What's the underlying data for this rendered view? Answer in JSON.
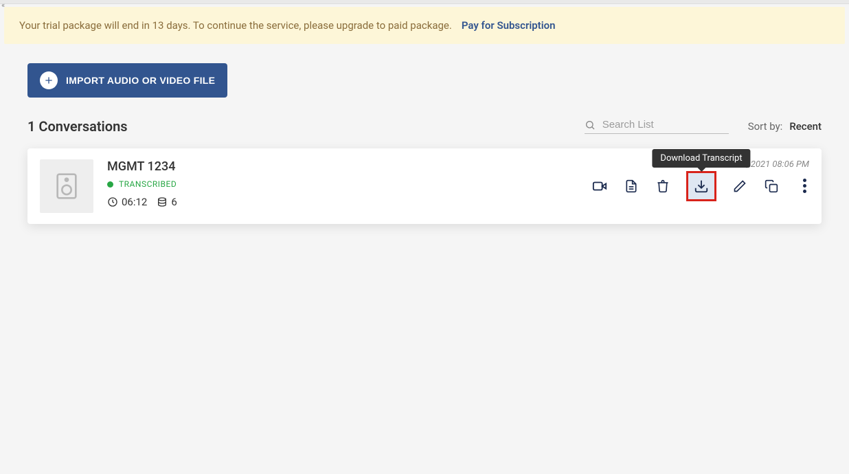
{
  "banner": {
    "message": "Your trial package will end in 13 days. To continue the service, please upgrade to paid package.",
    "link_label": "Pay for Subscription"
  },
  "import_button": "IMPORT AUDIO OR VIDEO FILE",
  "list": {
    "title": "1 Conversations",
    "search_placeholder": "Search List",
    "sort_label": "Sort by:",
    "sort_value": "Recent"
  },
  "conversation": {
    "title": "MGMT 1234",
    "status": "TRANSCRIBED",
    "duration": "06:12",
    "segments": "6",
    "datetime_visible_fragment": "20, 2021 08:06 PM"
  },
  "tooltip": {
    "download": "Download Transcript"
  },
  "icons": {
    "video": "video-icon",
    "transcript": "transcript-file-icon",
    "delete": "trash-icon",
    "download": "download-icon",
    "edit": "pencil-icon",
    "copy": "copy-icon",
    "more": "more-vertical-icon"
  }
}
